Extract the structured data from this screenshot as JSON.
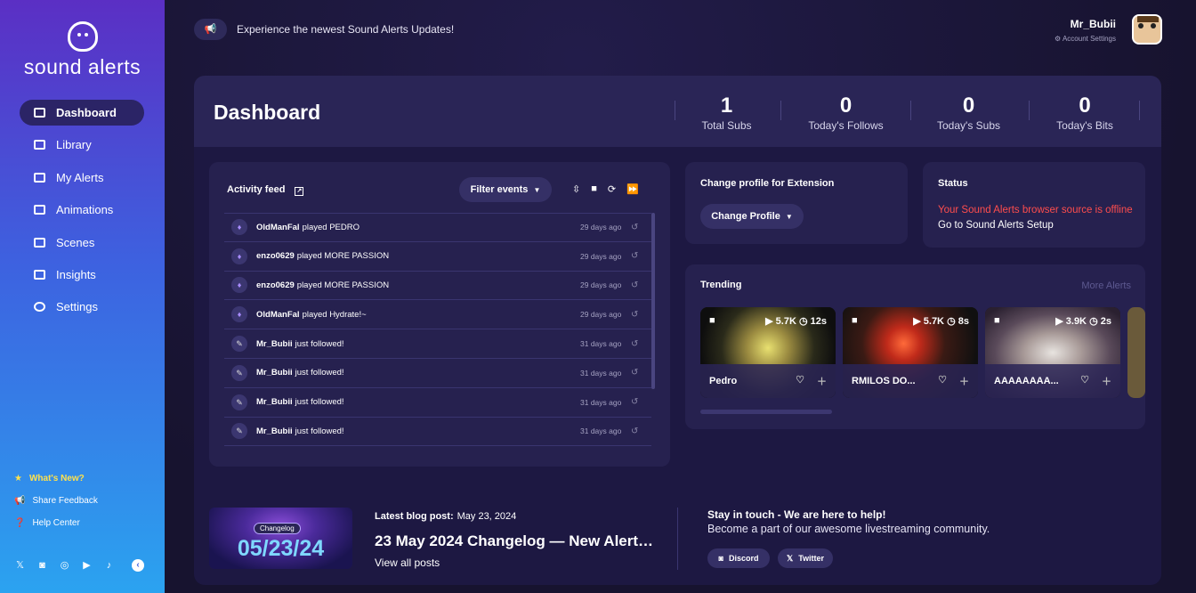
{
  "brand": {
    "name": "sound alerts"
  },
  "sidebar": {
    "items": [
      {
        "label": "Dashboard",
        "icon": "dashboard-icon"
      },
      {
        "label": "Library",
        "icon": "library-icon"
      },
      {
        "label": "My Alerts",
        "icon": "list-icon"
      },
      {
        "label": "Animations",
        "icon": "image-icon"
      },
      {
        "label": "Scenes",
        "icon": "scenes-icon"
      },
      {
        "label": "Insights",
        "icon": "insights-icon"
      },
      {
        "label": "Settings",
        "icon": "gear-icon"
      }
    ],
    "footer": {
      "whats_new": "What's New?",
      "feedback": "Share Feedback",
      "help": "Help Center"
    }
  },
  "header": {
    "announcement": "Experience the newest Sound Alerts Updates!",
    "username": "Mr_Bubii",
    "account_settings": "Account Settings"
  },
  "dashboard": {
    "title": "Dashboard",
    "stats": [
      {
        "value": "1",
        "label": "Total Subs"
      },
      {
        "value": "0",
        "label": "Today's Follows"
      },
      {
        "value": "0",
        "label": "Today's Subs"
      },
      {
        "value": "0",
        "label": "Today's Bits"
      }
    ]
  },
  "activity": {
    "title": "Activity feed",
    "filter_label": "Filter events",
    "rows": [
      {
        "user": "OldManFal",
        "action": "played PEDRO",
        "when": "29 days ago",
        "kind": "play"
      },
      {
        "user": "enzo0629",
        "action": "played MORE PASSION",
        "when": "29 days ago",
        "kind": "play"
      },
      {
        "user": "enzo0629",
        "action": "played MORE PASSION",
        "when": "29 days ago",
        "kind": "play"
      },
      {
        "user": "OldManFal",
        "action": "played Hydrate!~",
        "when": "29 days ago",
        "kind": "play"
      },
      {
        "user": "Mr_Bubii",
        "action": "just followed!",
        "when": "31 days ago",
        "kind": "follow"
      },
      {
        "user": "Mr_Bubii",
        "action": "just followed!",
        "when": "31 days ago",
        "kind": "follow"
      },
      {
        "user": "Mr_Bubii",
        "action": "just followed!",
        "when": "31 days ago",
        "kind": "follow"
      },
      {
        "user": "Mr_Bubii",
        "action": "just followed!",
        "when": "31 days ago",
        "kind": "follow"
      }
    ]
  },
  "profile": {
    "title": "Change profile for Extension",
    "button": "Change Profile"
  },
  "status": {
    "title": "Status",
    "message": "Your Sound Alerts browser source is offline",
    "link": "Go to Sound Alerts Setup",
    "error_color": "#ff4d4d"
  },
  "trending": {
    "title": "Trending",
    "more": "More Alerts",
    "cards": [
      {
        "name": "Pedro",
        "plays": "5.7K",
        "duration": "12s"
      },
      {
        "name": "RMILOS DO...",
        "plays": "5.7K",
        "duration": "8s"
      },
      {
        "name": "AAAAAAAA...",
        "plays": "3.9K",
        "duration": "2s"
      }
    ]
  },
  "blog": {
    "label": "Latest blog post:",
    "date": "May 23, 2024",
    "title": "23 May 2024 Changelog — New Alerts ...",
    "link": "View all posts",
    "thumb_tag": "Changelog",
    "thumb_date": "05/23/24"
  },
  "community": {
    "headline": "Stay in touch - We are here to help!",
    "subline": "Become a part of our awesome livestreaming community.",
    "discord": "Discord",
    "twitter": "Twitter"
  }
}
